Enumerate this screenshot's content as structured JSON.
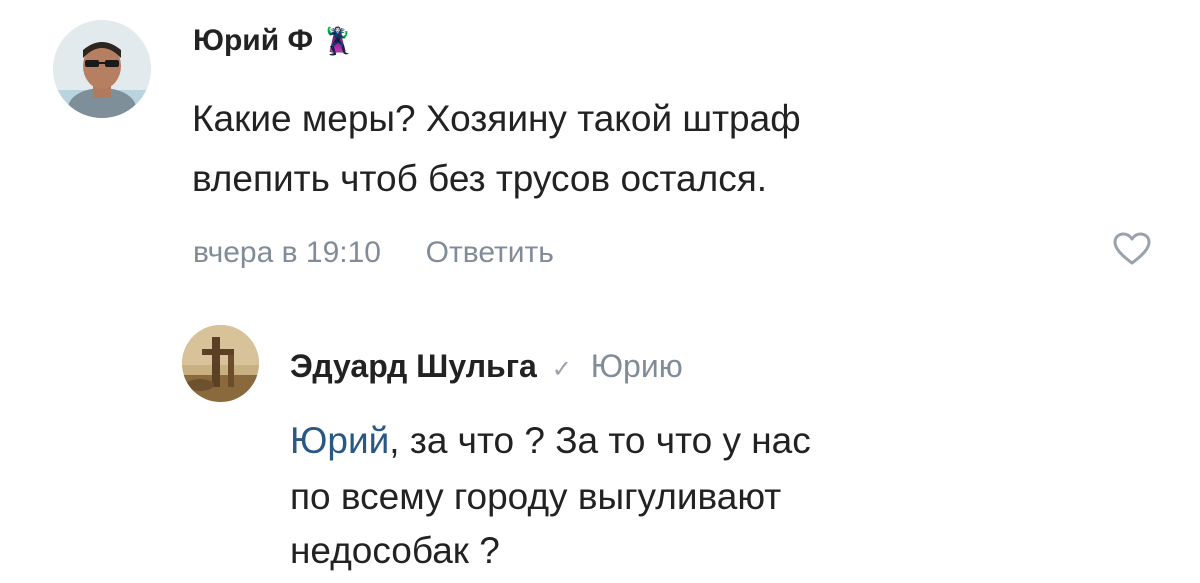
{
  "comment": {
    "author": "Юрий Ф",
    "emoji": "🦹",
    "line1": "Какие меры? Хозяину такой штраф",
    "line2": "влепить чтоб без трусов остался.",
    "time": "вчера в 19:10",
    "reply_label": "Ответить",
    "like_icon": "heart-outline-icon"
  },
  "reply": {
    "author": "Эдуард Шульга",
    "verified_mark": "✓",
    "reply_to": "Юрию",
    "mention": "Юрий",
    "line1_rest": ", за что ? За то что у нас",
    "line2": "по всему городу выгуливают",
    "line3": "недособак ?"
  },
  "colors": {
    "link": "#2a5885",
    "muted": "#818c99",
    "text": "#222222"
  }
}
